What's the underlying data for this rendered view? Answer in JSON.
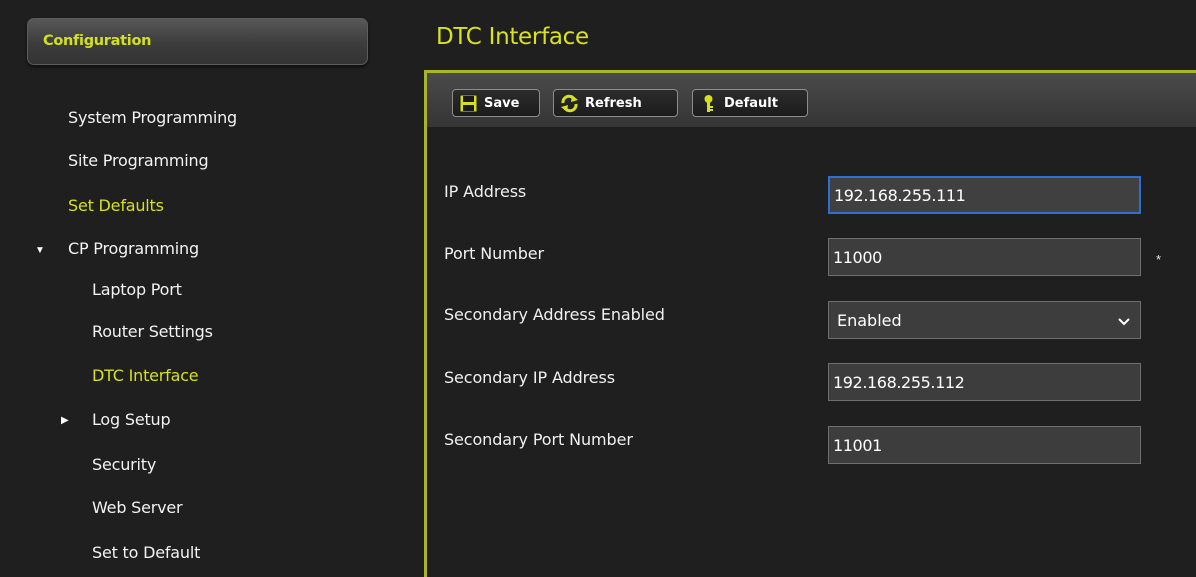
{
  "sidebar": {
    "header": "Configuration",
    "items": [
      {
        "label": "System Programming"
      },
      {
        "label": "Site Programming"
      },
      {
        "label": "Set Defaults"
      },
      {
        "label": "CP Programming"
      },
      {
        "label": "Laptop Port"
      },
      {
        "label": "Router Settings"
      },
      {
        "label": "DTC Interface"
      },
      {
        "label": "Log Setup"
      },
      {
        "label": "Security"
      },
      {
        "label": "Web Server"
      },
      {
        "label": "Set to Default"
      }
    ]
  },
  "page": {
    "title": "DTC Interface"
  },
  "toolbar": {
    "save_label": "Save",
    "refresh_label": "Refresh",
    "default_label": "Default"
  },
  "form": {
    "ip_address": {
      "label": "IP Address",
      "value": "192.168.255.111"
    },
    "port_number": {
      "label": "Port Number",
      "value": "11000",
      "required_mark": "*"
    },
    "secondary_enabled": {
      "label": "Secondary Address Enabled",
      "value": "Enabled"
    },
    "secondary_ip": {
      "label": "Secondary IP Address",
      "value": "192.168.255.112"
    },
    "secondary_port": {
      "label": "Secondary Port Number",
      "value": "11001"
    }
  },
  "colors": {
    "accent_yellow": "#d9e21d",
    "panel_border": "#a7b526",
    "background": "#1f1f1f",
    "focus_blue": "#2f6fd1"
  },
  "icons": {
    "save": "floppy-disk-icon",
    "refresh": "refresh-icon",
    "default": "key-icon"
  }
}
